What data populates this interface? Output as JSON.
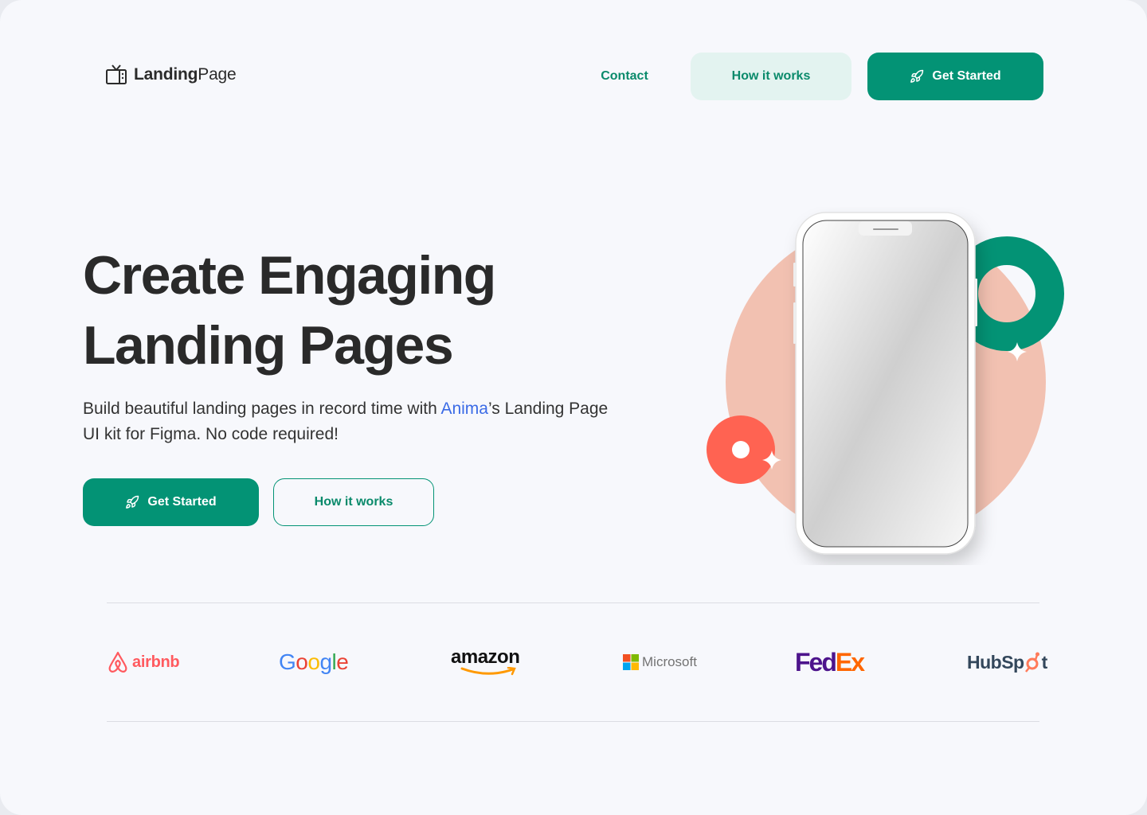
{
  "header": {
    "logo_bold": "Landing",
    "logo_light": "Page",
    "nav": {
      "contact": "Contact",
      "how_it_works": "How it works",
      "get_started": "Get Started"
    }
  },
  "hero": {
    "title_line1": "Create Engaging",
    "title_line2": "Landing Pages",
    "subtitle_before": "Build beautiful landing pages in record time with ",
    "subtitle_accent": "Anima",
    "subtitle_after": "’s Landing Page UI kit for Figma. No code required!",
    "get_started": "Get Started",
    "how_it_works": "How it works"
  },
  "brands": {
    "airbnb": "airbnb",
    "google_g": "G",
    "google_o1": "o",
    "google_o2": "o",
    "google_g2": "g",
    "google_l": "l",
    "google_e": "e",
    "amazon": "amazon",
    "microsoft": "Microsoft",
    "fed": "Fed",
    "ex": "Ex",
    "hubspot_a": "HubSp",
    "hubspot_b": "t"
  },
  "colors": {
    "primary": "#039375",
    "primary_light": "#e3f3f0",
    "accent_blue": "#3b6be6",
    "peach": "#f2c1b1",
    "coral": "#ff6352",
    "text_dark": "#2a2a2a"
  },
  "icons": {
    "logo": "tv-icon",
    "button": "rocket-icon"
  }
}
